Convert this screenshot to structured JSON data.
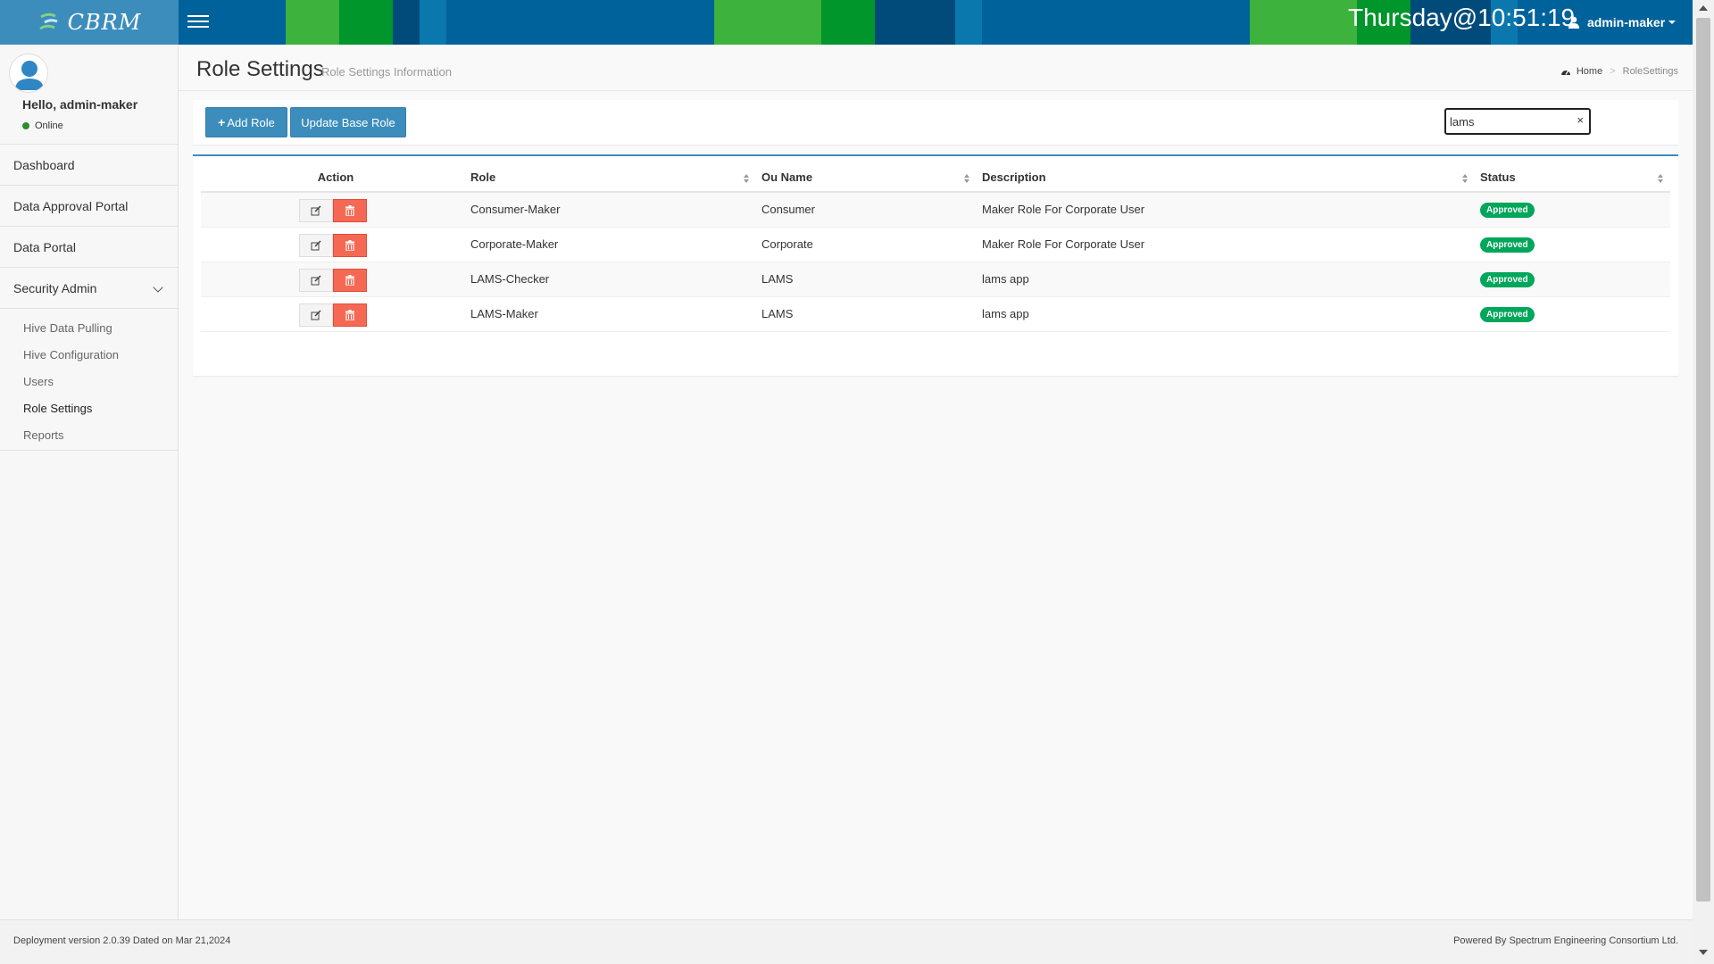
{
  "app": {
    "logo_text": "CBRM",
    "clock": "Thursday@10:51:19"
  },
  "header": {
    "user_label": "admin-maker",
    "colors": {
      "base": "#00629b",
      "light_green": "#3db23d",
      "green": "#00962b",
      "navy": "#004b7a",
      "teal": "#0a78ad"
    }
  },
  "sidebar": {
    "greeting": "Hello, admin-maker",
    "status": "Online",
    "items": [
      {
        "label": "Dashboard"
      },
      {
        "label": "Data Approval Portal"
      },
      {
        "label": "Data Portal"
      },
      {
        "label": "Security Admin"
      }
    ],
    "sub_items": [
      {
        "label": "Hive Data Pulling"
      },
      {
        "label": "Hive Configuration"
      },
      {
        "label": "Users"
      },
      {
        "label": "Role Settings"
      },
      {
        "label": "Reports"
      }
    ]
  },
  "page": {
    "title": "Role Settings",
    "subtitle": "Role Settings Information",
    "breadcrumb": {
      "home": "Home",
      "current": "RoleSettings"
    }
  },
  "toolbar": {
    "add_role": "Add Role",
    "update_base_role": "Update Base Role",
    "search_value": "lams"
  },
  "table": {
    "columns": [
      "Action",
      "Role",
      "Ou Name",
      "Description",
      "Status"
    ],
    "rows": [
      {
        "role": "Consumer-Maker",
        "ou": "Consumer",
        "description": "Maker Role For Corporate User",
        "status": "Approved"
      },
      {
        "role": "Corporate-Maker",
        "ou": "Corporate",
        "description": "Maker Role For Corporate User",
        "status": "Approved"
      },
      {
        "role": "LAMS-Checker",
        "ou": "LAMS",
        "description": "lams app",
        "status": "Approved"
      },
      {
        "role": "LAMS-Maker",
        "ou": "LAMS",
        "description": "lams app",
        "status": "Approved"
      }
    ]
  },
  "footer": {
    "left": "Deployment version 2.0.39 Dated on Mar 21,2024",
    "right": "Powered By Spectrum Engineering Consortium Ltd."
  }
}
